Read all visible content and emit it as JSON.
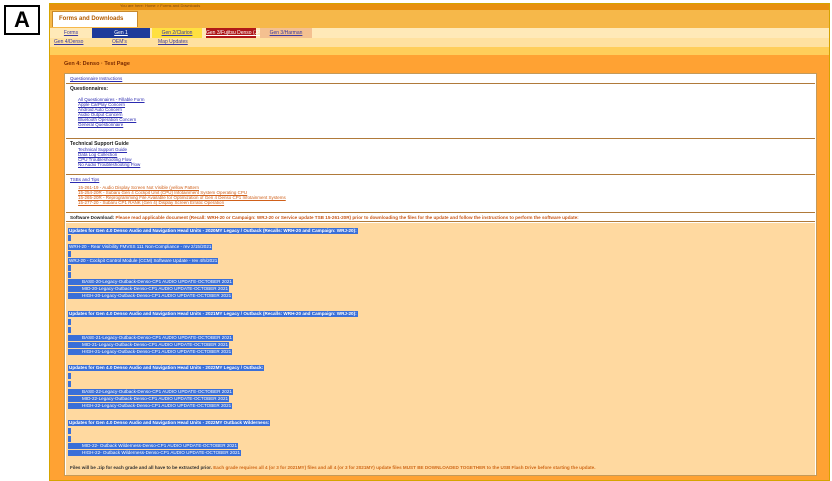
{
  "panel_label": "A",
  "header": {
    "top_strip_text": "You are here: Home > Forms and Downloads",
    "forms_tab": "Forms and Downloads",
    "nav_tabs": [
      "Forms",
      "Gen 1",
      "Gen 2/Clarion",
      "Gen 3/Fujitsu Denso (JP)",
      "Gen 3/Harman"
    ],
    "sub_tabs": [
      "Gen 4/Denso",
      "OEM's",
      "Map Updates"
    ]
  },
  "page_title": "Gen 4: Denso · Test Page",
  "sections": {
    "questionnaire_instructions": "Questionnaire Instructions",
    "questionnaires_title": "Questionnaires:",
    "questionnaires": [
      "All Questionnaires - Fillable Form",
      "Apple CarPlay Concern",
      "Android Auto Concern",
      "Audio Output Concern",
      "Bluetooth Operation Concern",
      "General Questionnaire"
    ],
    "tech_support_title": "Technical Support Guide",
    "tech_support": [
      "Technical Support Guide",
      "Data Log Collection",
      "CPU Troubleshooting Flow",
      "No Audio Troubleshooting Flow"
    ],
    "tips_title": "TSBs and Tips",
    "tips": [
      "15-261-19 - Audio Display Screen Not Visible (yellow Pattern",
      "15-254-20R - Subaru Gen 4 Cockpit Unit (CPU) Infotainment System Operating CPU",
      "15-265-20R - Reprogramming File Available for Optimization of Gen 4 Denso CP1 Infotainment Systems",
      "15-277-20 - Subaru CP1 RANK (Gen 4) Display Screen Erratic Operation"
    ]
  },
  "software_download": {
    "label": "Software Download:",
    "note": "Please read applicable document (Recall: WRH-20 or Campaign: WRJ-20 or Service update TSB 15-261-20R) prior to downloading the files for the update and follow the instructions to perform the software update:"
  },
  "updates": {
    "h_2020": "Updates for Gen 4.0 Denso Audio and Navigation Head Units - 2020MY Legacy / Outback (Recalls: WRH-20 and Campaign: WRJ-20):",
    "recall_line": "WRH-20 - Rear Visibility FMVSS 111 Non-Compliance - rev 2/15/2021",
    "campaign_line": "WRJ-20 - Cockpit Control Module (CCM) Software Update - rev 4/5/2021",
    "files_2020": [
      "BASE-20-Legacy-Outback-Denso-CP1 AUDIO UPDATE-OCTOBER 2021",
      "MID-20-Legacy-Outback-Denso-CP1 AUDIO UPDATE-OCTOBER 2021",
      "HIGH-20-Legacy-Outback-Denso-CP1 AUDIO UPDATE-OCTOBER 2021"
    ],
    "h_2021": "Updates for Gen 4.0 Denso Audio and Navigation Head Units - 2021MY Legacy / Outback (Recalls: WRH-20 and Campaign: WRJ-20):",
    "files_2021": [
      "BASE-21-Legacy-Outback-Denso-CP1 AUDIO UPDATE-OCTOBER 2021",
      "MID-21-Legacy-Outback-Denso-CP1 AUDIO UPDATE-OCTOBER 2021",
      "HIGH-21-Legacy-Outback-Denso-CP1 AUDIO UPDATE-OCTOBER 2021"
    ],
    "h_2022": "Updates for Gen 4.0 Denso Audio and Navigation Head Units - 2022MY Legacy / Outback:",
    "files_2022": [
      "BASE-22-Legacy-Outback-Denso-CP1 AUDIO UPDATE-OCTOBER 2021",
      "MID-22-Legacy-Outback-Denso-CP1 AUDIO UPDATE-OCTOBER 2021",
      "HIGH-22-Legacy-Outback-Denso-CP1 AUDIO UPDATE-OCTOBER 2021"
    ],
    "h_2022w": "Updates for Gen 4.0 Denso Audio and Navigation Head Units - 2022MY Outback Wilderness:",
    "files_2022w": [
      "MID-22- Outback Wilderness-Denso-CP1 AUDIO UPDATE-OCTOBER 2021",
      "HIGH-22- Outback Wilderness-Denso-CP1 AUDIO UPDATE-OCTOBER 2021"
    ],
    "footer_a": "Files will be .zip for each grade and all have to be extracted prior.",
    "footer_b": "Each grade requires all 4 (or 3 for 2021MY) files and all 4 (or 3 for 2021MY) update files MUST BE DOWNLOADED TOGETHER to the USB Flash Drive before starting the update."
  },
  "colors": {
    "page_orange": "#ffa233",
    "highlight_blue": "#3a6fd8",
    "updates_bg": "#ffd9a0",
    "link_blue": "#2b2bb0",
    "note_orange": "#c8581a"
  }
}
